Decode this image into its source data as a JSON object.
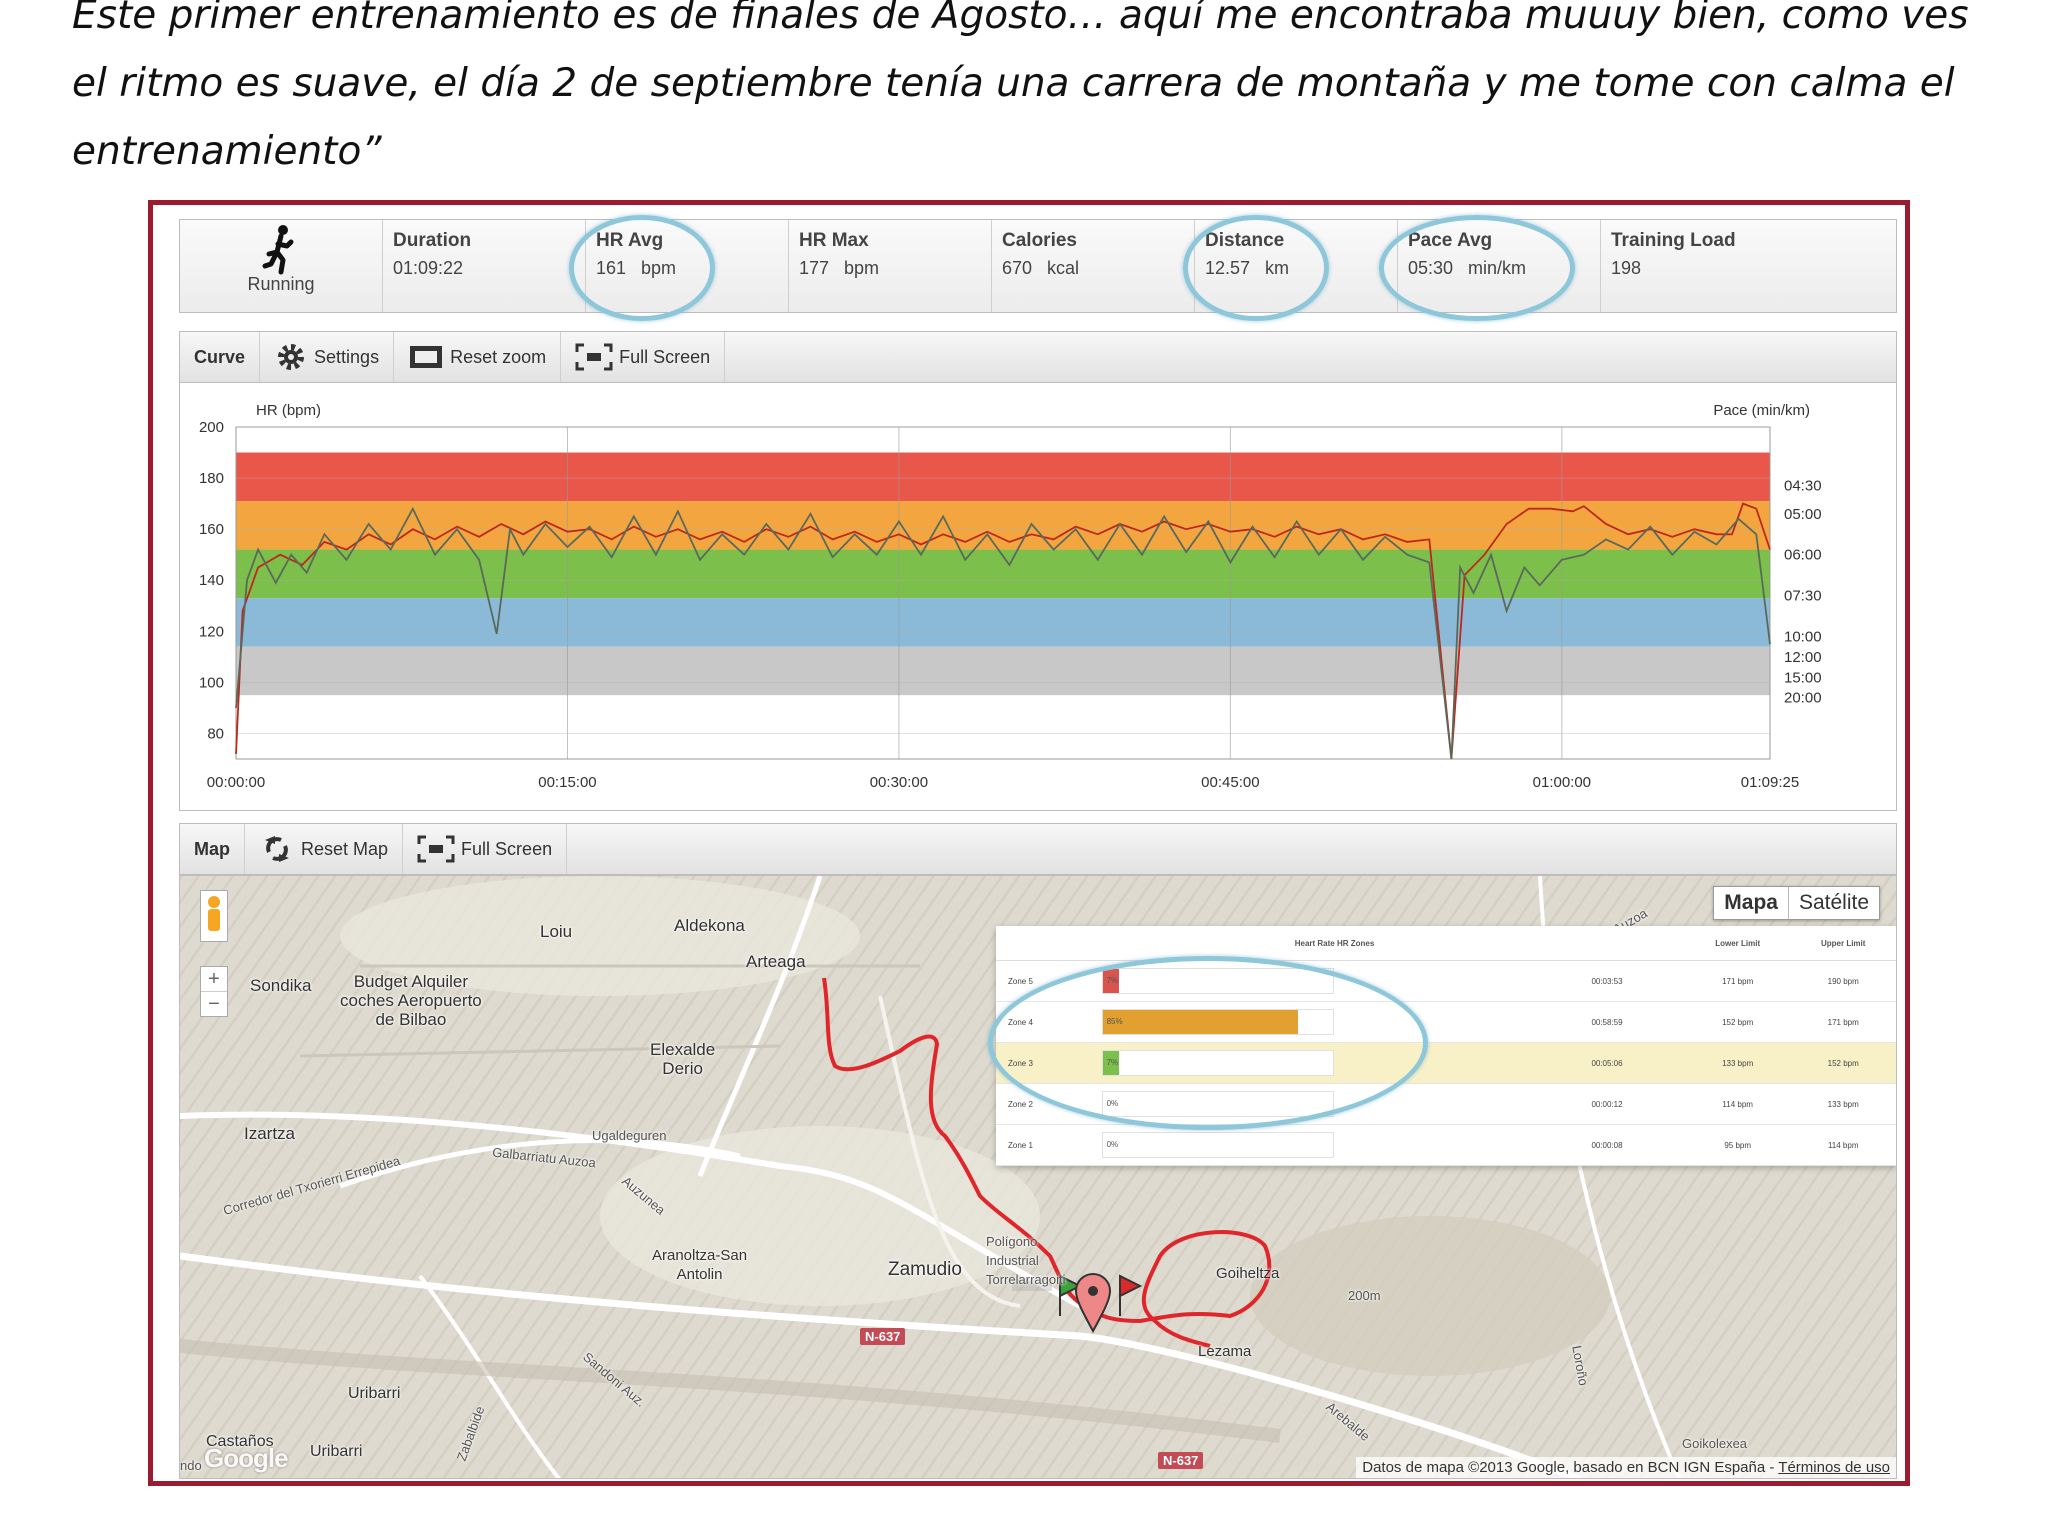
{
  "quote": {
    "line1": "Este primer entrenamiento es de finales de Agosto… aquí me encontraba muuuy bien, como ves",
    "line2": "el ritmo es suave, el día 2 de septiembre tenía una carrera de montaña y me tome con calma el",
    "line3": "entrenamiento”"
  },
  "stats": {
    "sport": "Running",
    "items": [
      {
        "label": "Duration",
        "value": "01:09:22"
      },
      {
        "label": "HR Avg",
        "value": "161   bpm"
      },
      {
        "label": "HR Max",
        "value": "177   bpm"
      },
      {
        "label": "Calories",
        "value": "670   kcal"
      },
      {
        "label": "Distance",
        "value": "12.57   km"
      },
      {
        "label": "Pace Avg",
        "value": "05:30   min/km"
      },
      {
        "label": "Training Load",
        "value": "198"
      }
    ]
  },
  "curve_toolbar": {
    "title": "Curve",
    "settings": "Settings",
    "reset_zoom": "Reset zoom",
    "full_screen": "Full Screen"
  },
  "chart_data": {
    "type": "line",
    "ylabel": "HR (bpm)",
    "y2label": "Pace (min/km)",
    "ylim": [
      70,
      200
    ],
    "y_ticks": [
      200,
      180,
      160,
      140,
      120,
      100,
      80
    ],
    "y2_ticks": [
      "04:30",
      "05:00",
      "06:00",
      "07:30",
      "10:00",
      "12:00",
      "15:00",
      "20:00"
    ],
    "y2_tick_hr": [
      177,
      166,
      150,
      134,
      118,
      110,
      102,
      94
    ],
    "x_ticks": [
      "00:00:00",
      "00:15:00",
      "00:30:00",
      "00:45:00",
      "01:00:00",
      "01:09:25"
    ],
    "x_tick_min": [
      0,
      15,
      30,
      45,
      60,
      69.42
    ],
    "xlim_min": [
      0,
      69.42
    ],
    "zones": [
      {
        "from": 171,
        "to": 190,
        "color": "#e9574a"
      },
      {
        "from": 152,
        "to": 171,
        "color": "#f3a640"
      },
      {
        "from": 133,
        "to": 152,
        "color": "#7cbf4a"
      },
      {
        "from": 114,
        "to": 133,
        "color": "#8bbad9"
      },
      {
        "from": 95,
        "to": 114,
        "color": "#c8c8c8"
      }
    ],
    "series": [
      {
        "color": "#c0271b",
        "points": [
          [
            0,
            72
          ],
          [
            0.3,
            128
          ],
          [
            1,
            145
          ],
          [
            2,
            150
          ],
          [
            3,
            146
          ],
          [
            4,
            155
          ],
          [
            5,
            152
          ],
          [
            6,
            158
          ],
          [
            7,
            154
          ],
          [
            8,
            160
          ],
          [
            9,
            156
          ],
          [
            10,
            161
          ],
          [
            11,
            157
          ],
          [
            12,
            162
          ],
          [
            13,
            158
          ],
          [
            14,
            163
          ],
          [
            15,
            159
          ],
          [
            16,
            160
          ],
          [
            17,
            156
          ],
          [
            18,
            161
          ],
          [
            19,
            157
          ],
          [
            20,
            160
          ],
          [
            21,
            156
          ],
          [
            22,
            159
          ],
          [
            23,
            155
          ],
          [
            24,
            160
          ],
          [
            25,
            157
          ],
          [
            26,
            161
          ],
          [
            27,
            156
          ],
          [
            28,
            159
          ],
          [
            29,
            155
          ],
          [
            30,
            158
          ],
          [
            31,
            154
          ],
          [
            32,
            158
          ],
          [
            33,
            155
          ],
          [
            34,
            159
          ],
          [
            35,
            155
          ],
          [
            36,
            158
          ],
          [
            37,
            156
          ],
          [
            38,
            161
          ],
          [
            39,
            158
          ],
          [
            40,
            162
          ],
          [
            41,
            159
          ],
          [
            42,
            163
          ],
          [
            43,
            160
          ],
          [
            44,
            162
          ],
          [
            45,
            159
          ],
          [
            46,
            160
          ],
          [
            47,
            157
          ],
          [
            48,
            161
          ],
          [
            49,
            158
          ],
          [
            50,
            160
          ],
          [
            51,
            156
          ],
          [
            52,
            158
          ],
          [
            53,
            155
          ],
          [
            54,
            156
          ],
          [
            55,
            70
          ],
          [
            55.6,
            142
          ],
          [
            56.5,
            150
          ],
          [
            57.5,
            162
          ],
          [
            58.5,
            168
          ],
          [
            59.5,
            168
          ],
          [
            60.5,
            167
          ],
          [
            61,
            169
          ],
          [
            62,
            162
          ],
          [
            63,
            158
          ],
          [
            64,
            160
          ],
          [
            65,
            157
          ],
          [
            66,
            160
          ],
          [
            67,
            158
          ],
          [
            67.7,
            158
          ],
          [
            68.2,
            170
          ],
          [
            68.8,
            168
          ],
          [
            69.42,
            152
          ]
        ]
      },
      {
        "color": "#5a6a5a",
        "points": [
          [
            0,
            90
          ],
          [
            0.5,
            140
          ],
          [
            1,
            152
          ],
          [
            1.8,
            139
          ],
          [
            2.5,
            150
          ],
          [
            3.2,
            143
          ],
          [
            4,
            158
          ],
          [
            5,
            148
          ],
          [
            6,
            162
          ],
          [
            7,
            152
          ],
          [
            8,
            168
          ],
          [
            9,
            150
          ],
          [
            10,
            160
          ],
          [
            11,
            148
          ],
          [
            11.8,
            119
          ],
          [
            12.4,
            160
          ],
          [
            13,
            150
          ],
          [
            14,
            162
          ],
          [
            15,
            153
          ],
          [
            16,
            161
          ],
          [
            17,
            149
          ],
          [
            18,
            165
          ],
          [
            19,
            150
          ],
          [
            20,
            167
          ],
          [
            21,
            148
          ],
          [
            22,
            158
          ],
          [
            23,
            150
          ],
          [
            24,
            162
          ],
          [
            25,
            152
          ],
          [
            26,
            166
          ],
          [
            27,
            149
          ],
          [
            28,
            158
          ],
          [
            29,
            150
          ],
          [
            30,
            163
          ],
          [
            31,
            150
          ],
          [
            32,
            165
          ],
          [
            33,
            148
          ],
          [
            34,
            158
          ],
          [
            35,
            146
          ],
          [
            36,
            162
          ],
          [
            37,
            152
          ],
          [
            38,
            160
          ],
          [
            39,
            148
          ],
          [
            40,
            162
          ],
          [
            41,
            150
          ],
          [
            42,
            165
          ],
          [
            43,
            151
          ],
          [
            44,
            163
          ],
          [
            45,
            147
          ],
          [
            46,
            161
          ],
          [
            47,
            149
          ],
          [
            48,
            163
          ],
          [
            49,
            150
          ],
          [
            50,
            160
          ],
          [
            51,
            148
          ],
          [
            52,
            157
          ],
          [
            53,
            150
          ],
          [
            54,
            147
          ],
          [
            55,
            70
          ],
          [
            55.4,
            145
          ],
          [
            56,
            135
          ],
          [
            56.8,
            150
          ],
          [
            57.5,
            128
          ],
          [
            58.3,
            145
          ],
          [
            59,
            138
          ],
          [
            60,
            148
          ],
          [
            61,
            150
          ],
          [
            62,
            156
          ],
          [
            63,
            152
          ],
          [
            64,
            161
          ],
          [
            65,
            150
          ],
          [
            66,
            159
          ],
          [
            67,
            154
          ],
          [
            68,
            164
          ],
          [
            68.8,
            158
          ],
          [
            69.42,
            115
          ]
        ]
      }
    ]
  },
  "map_toolbar": {
    "title": "Map",
    "reset_map": "Reset Map",
    "full_screen": "Full Screen"
  },
  "map": {
    "type_options": [
      "Mapa",
      "Satélite"
    ],
    "zoom_in": "+",
    "zoom_out": "−",
    "places": {
      "loiu": "Loiu",
      "aldekona": "Aldekona",
      "arteaga": "Arteaga",
      "sondika": "Sondika",
      "budget": "Budget Alquiler\ncoches Aeropuerto\nde Bilbao",
      "elexalde": "Elexalde\nDerio",
      "izartza": "Izartza",
      "ugaldeguren": "Ugaldeguren",
      "corredor": "Corredor del Txorierri Errepidea",
      "galbarriatu": "Galbarriatu Auzoa",
      "auzunea": "Auzunea",
      "aranoltza": "Aranoltza-San\nAntolin",
      "zamudio": "Zamudio",
      "poligono": "Polígono\nIndustrial\nTorrelarragoiti",
      "goiheltza": "Goiheltza",
      "lezama": "Lezama",
      "uribarri": "Uribarri",
      "castanos": "Castaños",
      "uribarri2": "Uribarri",
      "goikolexea": "Goikolexea",
      "n637": "N-637",
      "n637b": "N-637",
      "contour": "200m",
      "loroño": "Loroño",
      "sandoni": "Sandoni Auz.",
      "zabalbide": "Zabalbide",
      "arebalde": "Arebalde",
      "ndo": "ndo",
      "azuaza": "Azu Auzoa"
    },
    "copyright": "Datos de mapa ©2013 Google, basado en BCN IGN España - ",
    "terms": "Términos de uso",
    "google_logo": "Google"
  },
  "zones_table": {
    "headers": [
      "",
      "Heart Rate HR Zones",
      "",
      "Lower Limit",
      "Upper Limit"
    ],
    "rows": [
      {
        "zone": "Zone 5",
        "pct": "7%",
        "pct_value": 0.07,
        "color": "#d9534f",
        "time": "00:03:53",
        "lower": "171 bpm",
        "upper": "190 bpm",
        "selected": false
      },
      {
        "zone": "Zone 4",
        "pct": "85%",
        "pct_value": 0.85,
        "color": "#e2a030",
        "time": "00:58:59",
        "lower": "152 bpm",
        "upper": "171 bpm",
        "selected": false
      },
      {
        "zone": "Zone 3",
        "pct": "7%",
        "pct_value": 0.07,
        "color": "#7cbf4a",
        "time": "00:05:06",
        "lower": "133 bpm",
        "upper": "152 bpm",
        "selected": true
      },
      {
        "zone": "Zone 2",
        "pct": "0%",
        "pct_value": 0.0,
        "color": "#8bbad9",
        "time": "00:00:12",
        "lower": "114 bpm",
        "upper": "133 bpm",
        "selected": false
      },
      {
        "zone": "Zone 1",
        "pct": "0%",
        "pct_value": 0.0,
        "color": "#c8c8c8",
        "time": "00:00:08",
        "lower": "95 bpm",
        "upper": "114 bpm",
        "selected": false
      }
    ]
  },
  "colors": {
    "frame": "#9b1b30",
    "highlight_circle": "#8ec7d9",
    "route": "#e0262b"
  }
}
